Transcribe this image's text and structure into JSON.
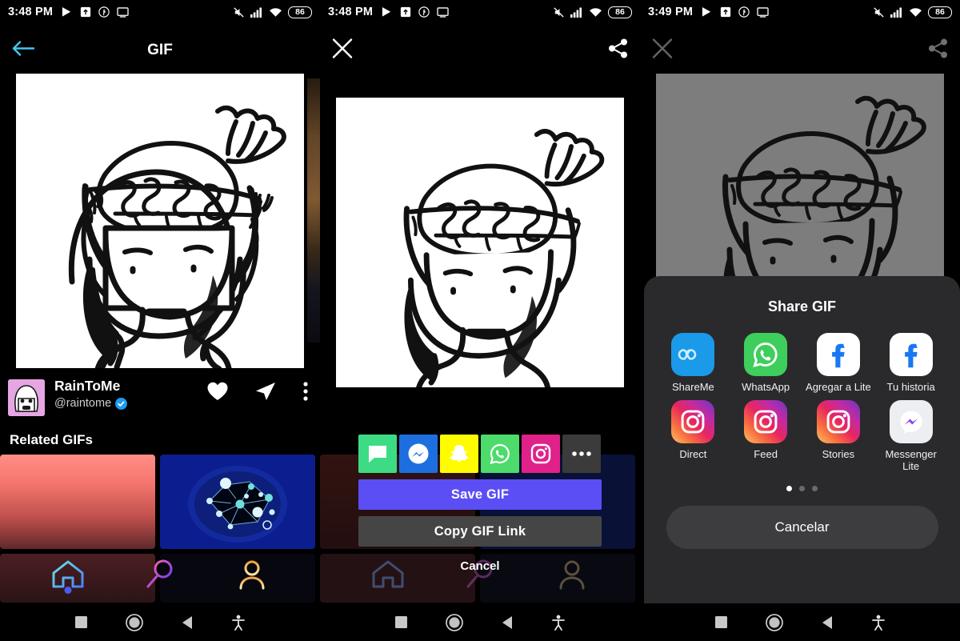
{
  "panels": [
    {
      "status": {
        "time": "3:48 PM",
        "battery": "86",
        "icons": [
          "play-store-icon",
          "upload-box-icon",
          "facebook-circle-icon",
          "screencast-icon"
        ],
        "right_icons": [
          "mute-icon",
          "signal-bars-icon",
          "wifi-icon"
        ]
      },
      "topbar": {
        "back_icon": "back-arrow-icon",
        "title": "GIF"
      },
      "user": {
        "name": "RainToMe",
        "handle": "@raintome",
        "verified": true,
        "actions": [
          "heart-icon",
          "send-icon",
          "more-vertical-icon"
        ]
      },
      "section_title": "Related GIFs",
      "nav": [
        {
          "name": "home",
          "icon": "home-icon",
          "active": true
        },
        {
          "name": "search",
          "icon": "search-icon",
          "active": false
        },
        {
          "name": "profile",
          "icon": "profile-icon",
          "active": false
        }
      ]
    },
    {
      "status": {
        "time": "3:48 PM",
        "battery": "86"
      },
      "topbar": {
        "close_icon": "close-icon",
        "share_icon": "share-icon"
      },
      "share_dialog": {
        "apps": [
          {
            "name": "Messages",
            "icon": "message-bubble-icon",
            "color": "#3ddc84"
          },
          {
            "name": "Messenger",
            "icon": "messenger-icon",
            "color": "#1d6fe0"
          },
          {
            "name": "Snapchat",
            "icon": "snapchat-ghost-icon",
            "color": "#fffc00"
          },
          {
            "name": "WhatsApp",
            "icon": "whatsapp-icon",
            "color": "#4ddb6b"
          },
          {
            "name": "Instagram",
            "icon": "instagram-icon",
            "color": "#e0218a"
          },
          {
            "name": "More",
            "icon": "more-horizontal-icon",
            "color": "#3b3b3b"
          }
        ],
        "save_label": "Save GIF",
        "copy_label": "Copy GIF Link",
        "cancel_label": "Cancel"
      }
    },
    {
      "status": {
        "time": "3:49 PM",
        "battery": "86"
      },
      "topbar": {
        "close_icon": "close-icon",
        "share_icon": "share-icon"
      },
      "share_sheet": {
        "title": "Share GIF",
        "targets": [
          {
            "label": "ShareMe",
            "icon": "shareme-icon"
          },
          {
            "label": "WhatsApp",
            "icon": "whatsapp-icon"
          },
          {
            "label": "Agregar a Lite",
            "icon": "facebook-icon"
          },
          {
            "label": "Tu historia",
            "icon": "facebook-icon"
          },
          {
            "label": "Direct",
            "icon": "instagram-icon"
          },
          {
            "label": "Feed",
            "icon": "instagram-icon"
          },
          {
            "label": "Stories",
            "icon": "instagram-icon"
          },
          {
            "label": "Messenger Lite",
            "icon": "messenger-lite-icon"
          }
        ],
        "page_dots": 3,
        "active_dot": 0,
        "cancel_label": "Cancelar"
      }
    }
  ],
  "sysnav": {
    "items": [
      "recents-square-icon",
      "home-circle-icon",
      "back-triangle-icon",
      "accessibility-icon"
    ]
  },
  "colors": {
    "accent_purple": "#5b4ef5",
    "verified_blue": "#1d9bf0",
    "sheet_bg": "#2a2a2c",
    "back_arrow": "#43c6f0"
  }
}
